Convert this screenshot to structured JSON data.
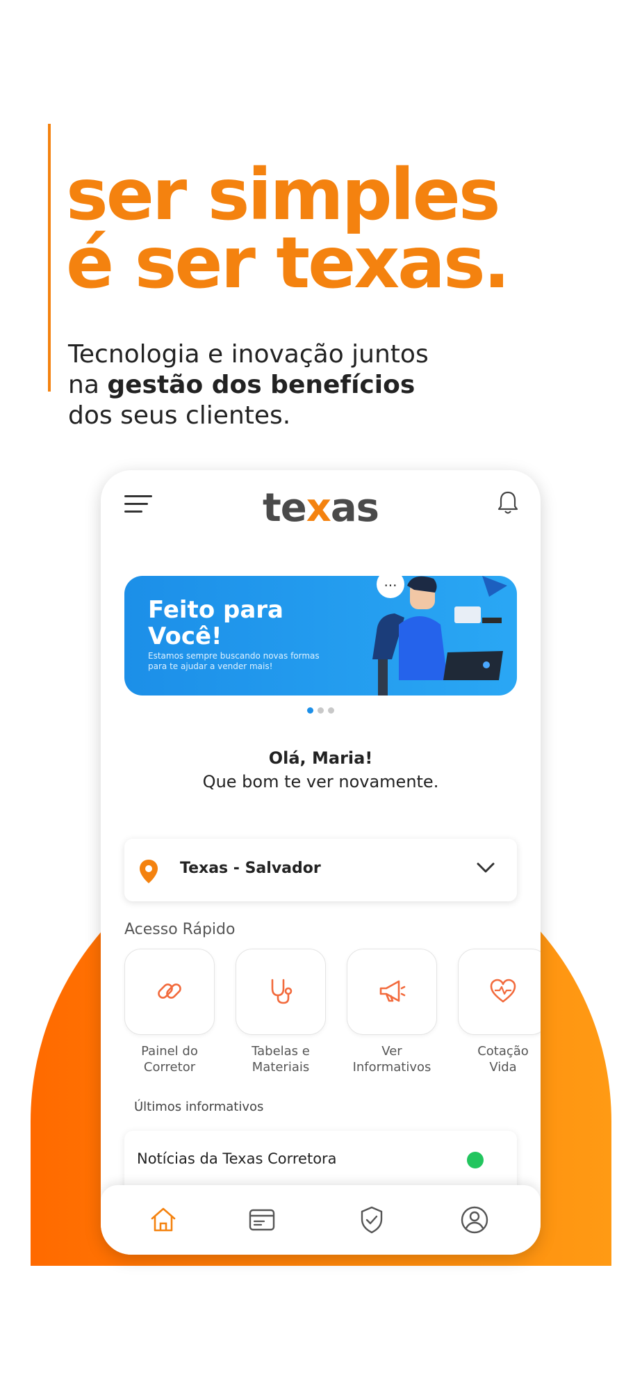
{
  "hero": {
    "headline_line1": "ser simples",
    "headline_line2": "é ser texas.",
    "sub_line1": "Tecnologia e inovação juntos",
    "sub_line2_prefix": "na ",
    "sub_line2_bold": "gestão dos benefícios",
    "sub_line3": "dos seus clientes."
  },
  "app": {
    "logo_left": "te",
    "logo_x": "x",
    "logo_right": "as",
    "banner": {
      "title_line1": "Feito para",
      "title_line2": "Você!",
      "subtitle": "Estamos sempre buscando novas formas para te ajudar a vender mais!",
      "speech_bubble": "..."
    },
    "carousel": {
      "count": 3,
      "active_index": 0
    },
    "greeting": {
      "hello": "Olá, Maria!",
      "welcome": "Que bom te ver novamente."
    },
    "location": {
      "label": "Texas - Salvador"
    },
    "quick_access": {
      "title": "Acesso Rápido",
      "items": [
        {
          "line1": "Painel do",
          "line2": "Corretor",
          "icon": "link-icon"
        },
        {
          "line1": "Tabelas e",
          "line2": "Materiais",
          "icon": "stethoscope-icon"
        },
        {
          "line1": "Ver",
          "line2": "Informativos",
          "icon": "megaphone-icon"
        },
        {
          "line1": "Cotação",
          "line2": "Vida",
          "icon": "heart-pulse-icon"
        }
      ]
    },
    "latest": {
      "title": "Últimos informativos",
      "items": [
        {
          "label": "Notícias da Texas Corretora",
          "status_color": "#22c55e"
        }
      ]
    },
    "tabbar": [
      "home-icon",
      "card-icon",
      "shield-icon",
      "profile-icon"
    ]
  },
  "colors": {
    "accent": "#f4820f",
    "banner_blue": "#1c8fe8",
    "status_green": "#22c55e"
  }
}
